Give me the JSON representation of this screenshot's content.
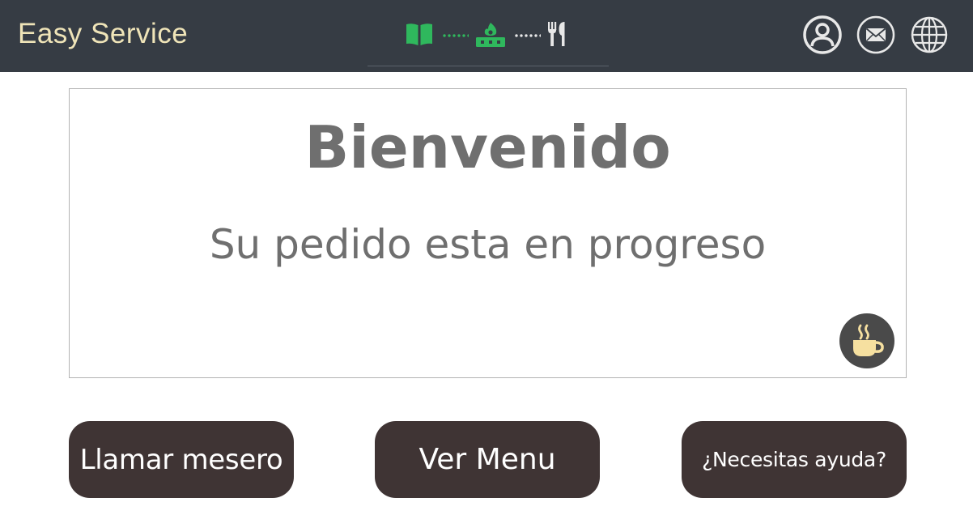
{
  "app": {
    "brand": "Easy Service",
    "brand_color": "#efe4b8",
    "topbar_color": "#363c44"
  },
  "order_progress": {
    "steps": [
      {
        "icon": "menu-book-icon",
        "state": "done"
      },
      {
        "icon": "stove-icon",
        "state": "active"
      },
      {
        "icon": "utensils-icon",
        "state": "pending"
      }
    ],
    "done_color": "#2fb85d"
  },
  "header_actions": {
    "icons": [
      "user-profile-icon",
      "mail-icon",
      "globe-icon"
    ]
  },
  "welcome": {
    "title": "Bienvenido",
    "message": "Su pedido esta en progreso",
    "badge_icon": "coffee-cup-icon"
  },
  "actions": {
    "call_waiter": "Llamar mesero",
    "view_menu": "Ver Menu",
    "help": "¿Necesitas ayuda?",
    "button_color": "#3f3434"
  }
}
